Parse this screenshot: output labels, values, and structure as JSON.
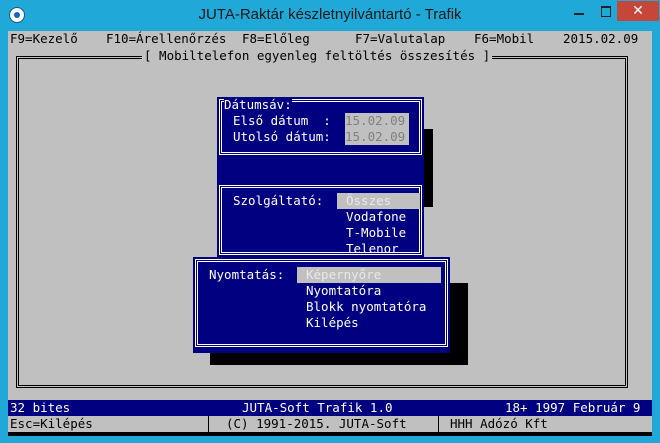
{
  "window": {
    "title": "JUTA-Raktár készletnyilvántartó - Trafik",
    "min_label": "",
    "max_label": "",
    "close_label": "✕"
  },
  "menubar": {
    "items": [
      {
        "label": "F9=Kezelő"
      },
      {
        "label": "F10=Árellenőrzés"
      },
      {
        "label": "F8=Előleg"
      },
      {
        "label": "F7=Valutalap"
      },
      {
        "label": "F6=Mobil"
      }
    ],
    "date": "2015.02.09"
  },
  "main": {
    "frame_title": "[ Mobiltelefon egyenleg feltöltés összesítés ]",
    "date_range": {
      "title": "Dátumsáv:",
      "first_label": "Első dátum  :",
      "first_value": "15.02.09",
      "last_label": "Utolsó dátum:",
      "last_value": "15.02.09"
    },
    "provider": {
      "label": "Szolgáltató:",
      "options": [
        "Összes",
        "Vodafone",
        "T-Mobile",
        "Telenor"
      ],
      "selected": "Összes"
    },
    "print": {
      "label": "Nyomtatás:",
      "options": [
        "Képernyőre",
        "Nyomtatóra",
        "Blokk nyomtatóra",
        "Kilépés"
      ],
      "selected": "Képernyőre"
    }
  },
  "status1": {
    "left": "32 bites",
    "center": "JUTA-Soft Trafik 1.0",
    "right": "18+ 1997 Február 9"
  },
  "status2": {
    "left": "Esc=Kilépés",
    "center": "(C) 1991-2015. JUTA-Soft",
    "right": "HHH Adózó Kft"
  },
  "colors": {
    "titlebar": "#1fa8d8",
    "panel": "#000080",
    "grey": "#c0c0c0",
    "close": "#c7463a"
  }
}
